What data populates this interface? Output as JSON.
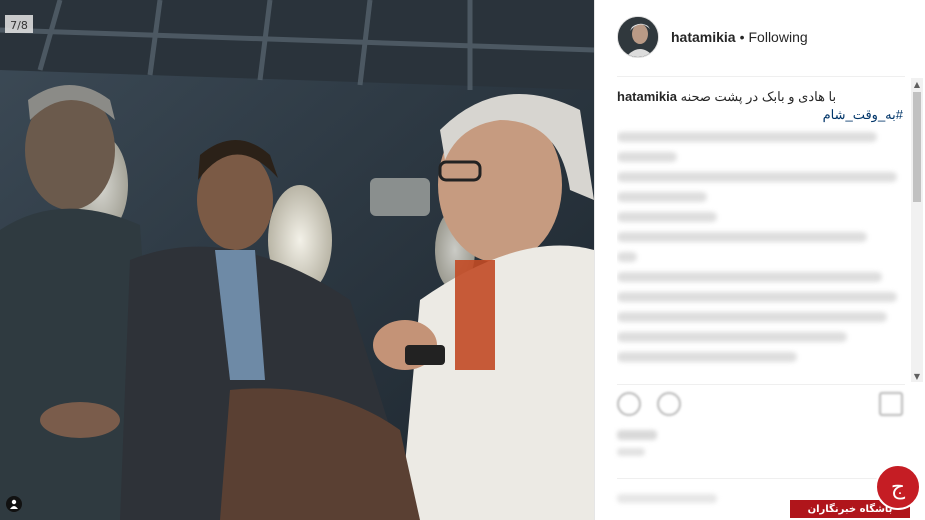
{
  "post": {
    "username": "hatamikia",
    "separator": "•",
    "follow_status": "Following",
    "caption_text": "با هادی و بابک در پشت صحنه",
    "caption_hashtag": "#به_وقت_شام",
    "photo_label": "7/8"
  },
  "icons": {
    "user_tag": "person-icon",
    "scroll_up": "triangle-up-icon",
    "scroll_down": "triangle-down-icon",
    "like": "heart-icon",
    "comment": "comment-icon",
    "save": "bookmark-icon"
  },
  "watermark": {
    "text": "باشگاه خبرنگاران",
    "logo_text": "ج"
  },
  "colors": {
    "link": "#003569",
    "watermark_red": "#c51d24"
  }
}
